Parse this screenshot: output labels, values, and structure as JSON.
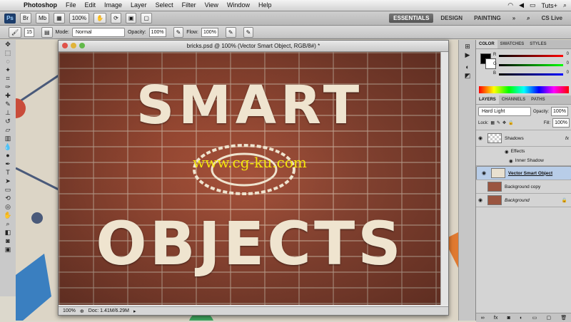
{
  "menubar": {
    "apple_icon": "apple-icon",
    "items": [
      "Photoshop",
      "File",
      "Edit",
      "Image",
      "Layer",
      "Select",
      "Filter",
      "View",
      "Window",
      "Help"
    ],
    "user": "Tuts+"
  },
  "appbar": {
    "badge": "Ps",
    "zoom": "100%",
    "workspaces": [
      {
        "label": "ESSENTIALS",
        "active": true
      },
      {
        "label": "DESIGN",
        "active": false
      },
      {
        "label": "PAINTING",
        "active": false
      }
    ],
    "cs_live": "CS Live"
  },
  "options": {
    "brush_size": "15",
    "mode_label": "Mode:",
    "mode_value": "Normal",
    "opacity_label": "Opacity:",
    "opacity_value": "100%",
    "flow_label": "Flow:",
    "flow_value": "100%"
  },
  "document": {
    "title": "bricks.psd @ 100% (Vector Smart Object, RGB/8#) *",
    "line1": "SMART",
    "line2": "OBJECTS",
    "watermark": "www.cg-ku.com",
    "status_zoom": "100%",
    "status_doc": "Doc: 1.41M/6.29M"
  },
  "color_panel": {
    "tabs": [
      {
        "label": "COLOR",
        "active": true
      },
      {
        "label": "SWATCHES",
        "active": false
      },
      {
        "label": "STYLES",
        "active": false
      }
    ],
    "channels": [
      "R",
      "G",
      "B"
    ],
    "values": [
      "0",
      "0",
      "0"
    ]
  },
  "layers_panel": {
    "tabs": [
      {
        "label": "LAYERS",
        "active": true
      },
      {
        "label": "CHANNELS",
        "active": false
      },
      {
        "label": "PATHS",
        "active": false
      }
    ],
    "blend_mode": "Hard Light",
    "opacity_label": "Opacity:",
    "opacity_value": "100%",
    "lock_label": "Lock:",
    "fill_label": "Fill:",
    "fill_value": "100%",
    "layers": [
      {
        "name": "Shadows",
        "fx": "fx"
      },
      {
        "name": "Effects"
      },
      {
        "name": "Inner Shadow"
      },
      {
        "name": "Vector Smart Object"
      },
      {
        "name": "Background copy"
      },
      {
        "name": "Background"
      }
    ]
  },
  "colors": {
    "accent": "#b8cde8",
    "watermark": "#f3e60c",
    "text": "#efe4cf"
  }
}
